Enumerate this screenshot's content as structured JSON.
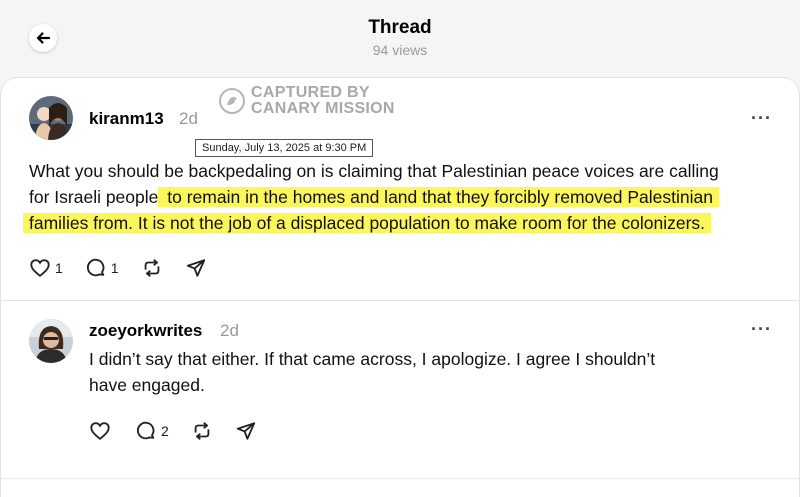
{
  "header": {
    "title": "Thread",
    "views": "94 views"
  },
  "watermark": {
    "line1": "CAPTURED BY",
    "line2": "CANARY MISSION"
  },
  "tooltip": {
    "text": "Sunday, July 13, 2025 at 9:30 PM"
  },
  "posts": [
    {
      "username": "kiranm13",
      "time": "2d",
      "text_line1": "What you should be backpedaling on is claiming that Palestinian peace voices are calling",
      "text_line2_plain": "for Israeli people",
      "text_line2_hl": " to remain in the homes and land that they forcibly removed Palestinian",
      "text_line3_hl": "families from. It is not the job of a displaced population to make room for the colonizers.",
      "likes": "1",
      "replies": "1"
    },
    {
      "username": "zoeyorkwrites",
      "time": "2d",
      "text_line1": "I didn’t say that either. If that came across, I apologize. I agree I shouldn’t",
      "text_line2": "have engaged.",
      "likes": "",
      "replies": "2"
    }
  ],
  "icons": {
    "back": "arrow-left-icon",
    "more": "more-horizontal-icon",
    "like": "heart-icon",
    "reply": "comment-icon",
    "repost": "repost-icon",
    "share": "send-icon"
  },
  "colors": {
    "highlight": "#fbf65a",
    "muted_text": "#999999",
    "background": "#f5f5f5"
  }
}
